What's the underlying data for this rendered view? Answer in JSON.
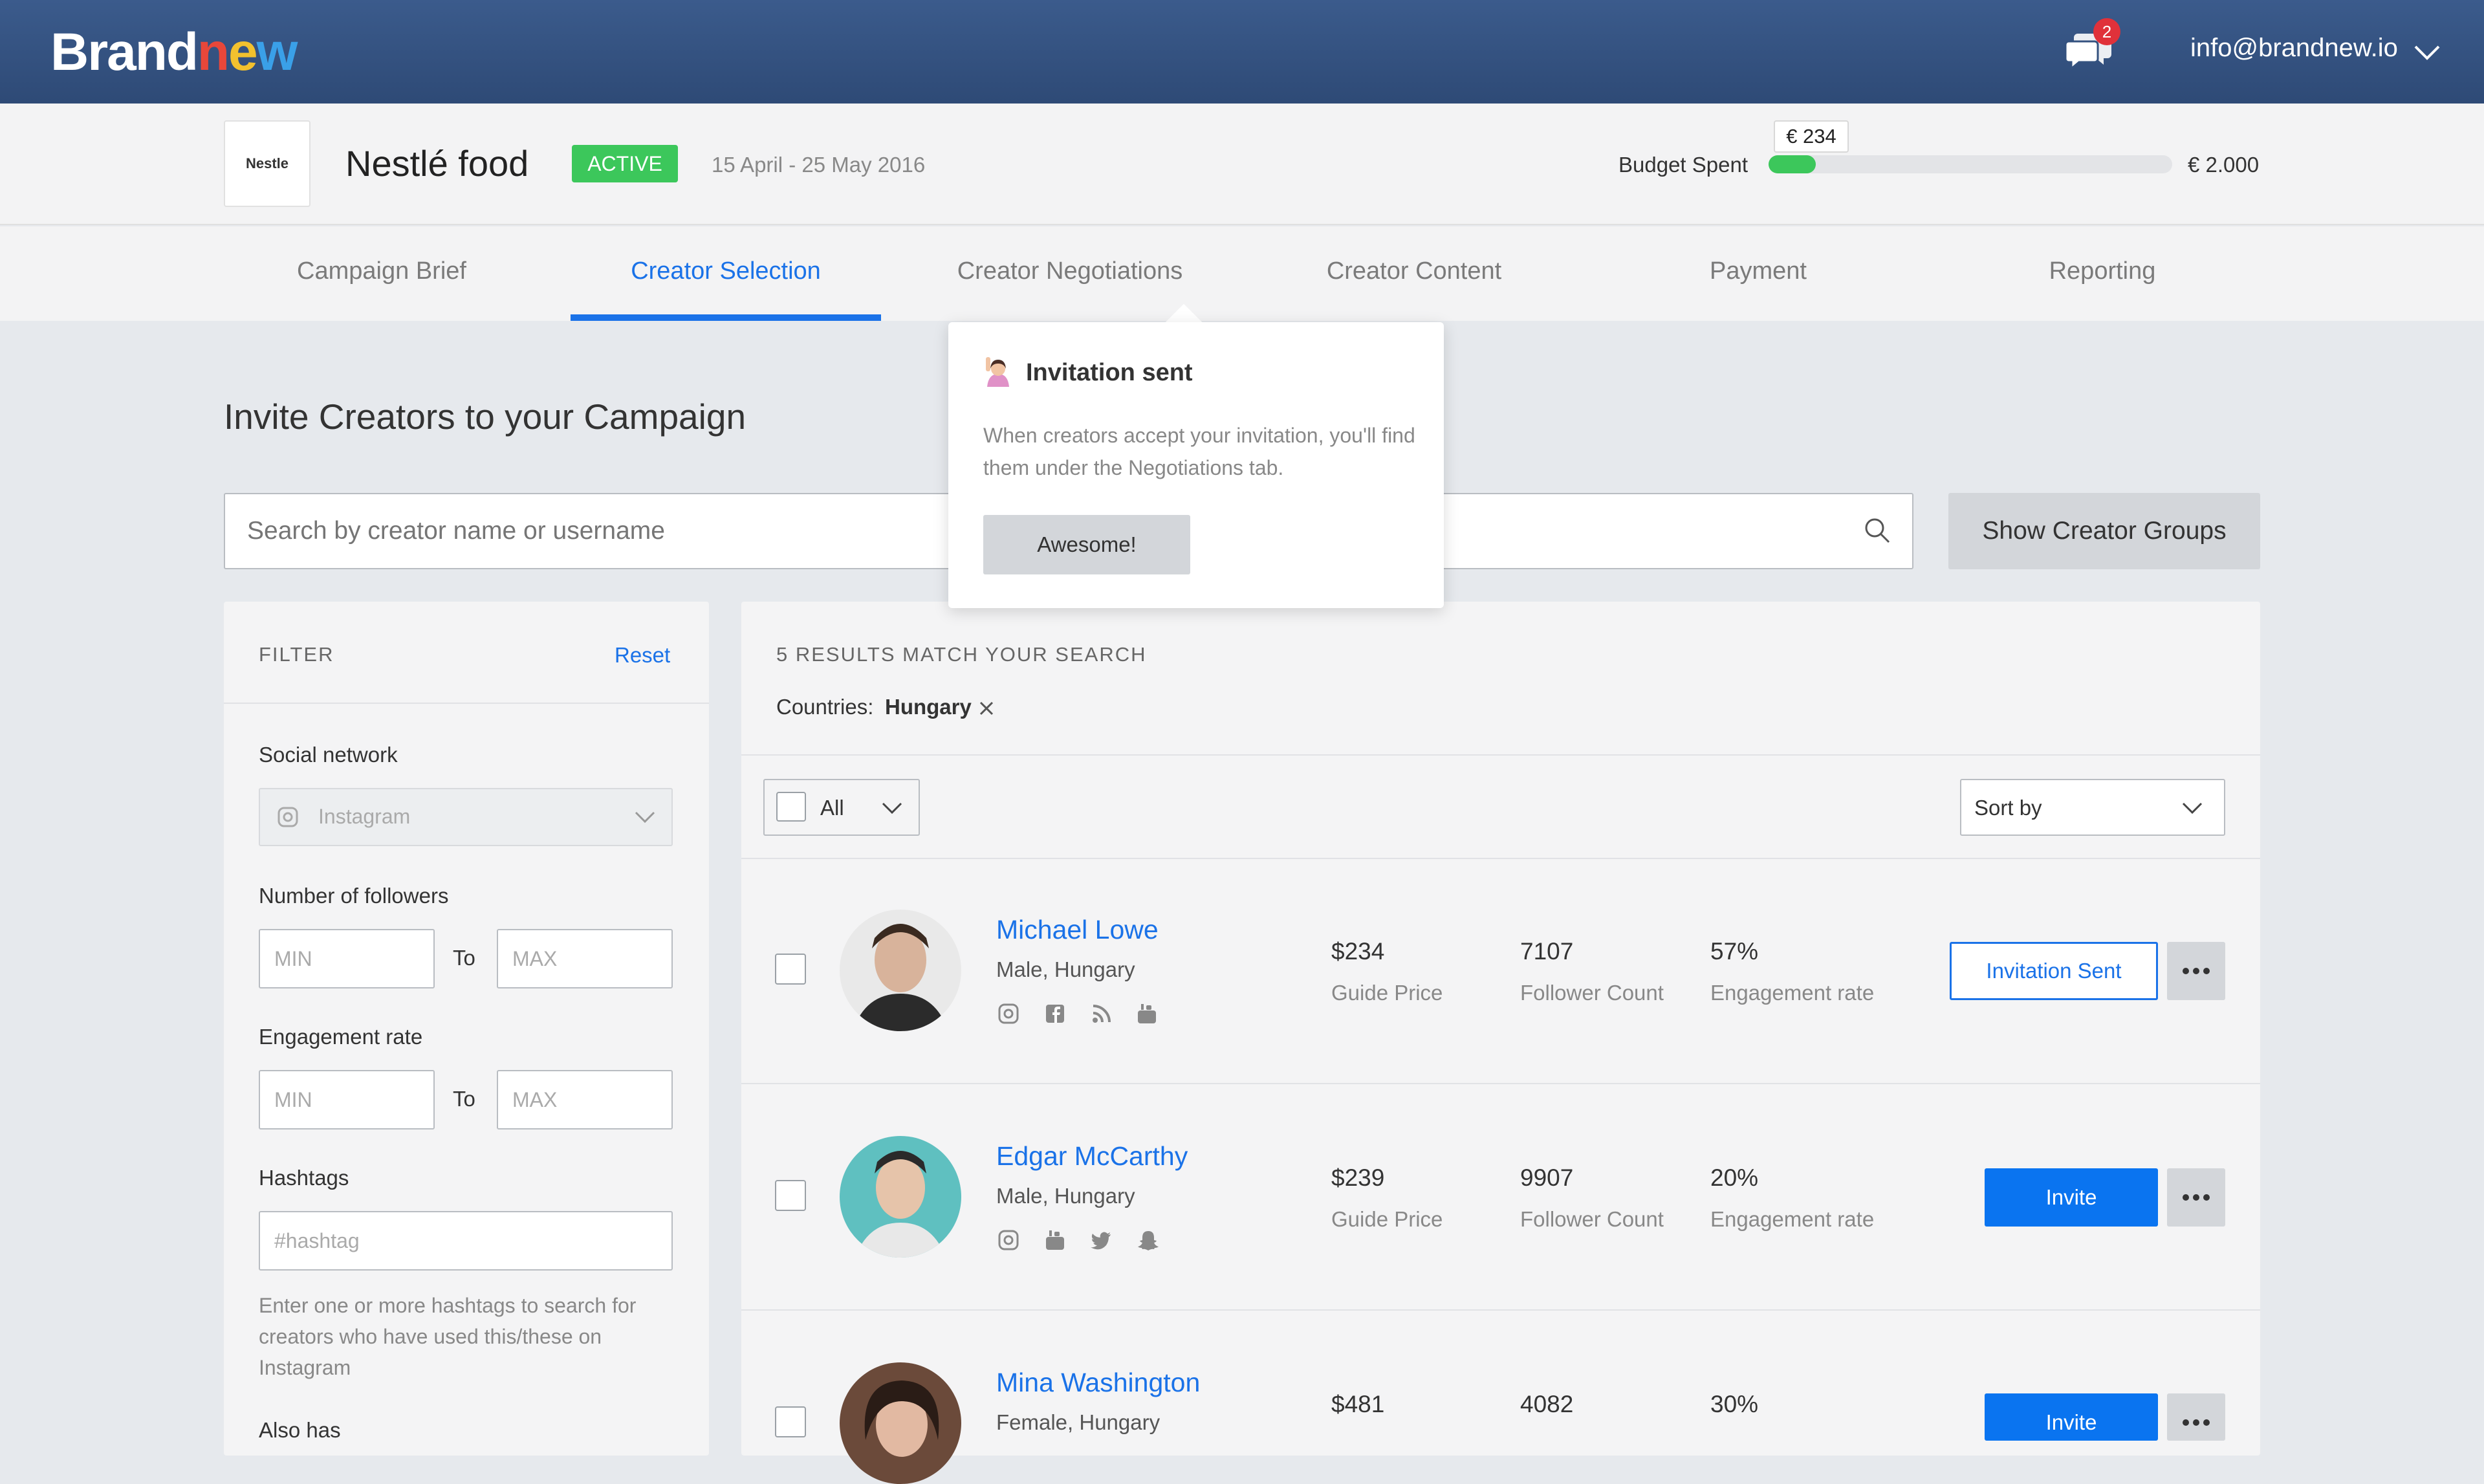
{
  "header": {
    "logo": {
      "part1": "Brand",
      "part2_n": "n",
      "part2_e": "e",
      "part2_w": "w"
    },
    "notifications_count": "2",
    "user_email": "info@brandnew.io"
  },
  "campaign": {
    "brand_logo_text": "Nestle",
    "title": "Nestlé food",
    "status": "ACTIVE",
    "dates": "15 April - 25 May 2016",
    "budget_label": "Budget Spent",
    "budget_spent": "€ 234",
    "budget_total": "€ 2.000",
    "budget_fraction": 0.117
  },
  "tabs": [
    {
      "label": "Campaign Brief"
    },
    {
      "label": "Creator Selection"
    },
    {
      "label": "Creator Negotiations"
    },
    {
      "label": "Creator Content"
    },
    {
      "label": "Payment"
    },
    {
      "label": "Reporting"
    }
  ],
  "page": {
    "heading": "Invite Creators to your Campaign",
    "search_placeholder": "Search by creator name or username",
    "show_groups_label": "Show Creator Groups"
  },
  "filter": {
    "title": "FILTER",
    "reset": "Reset",
    "social_label": "Social network",
    "social_value": "Instagram",
    "followers_label": "Number of followers",
    "engagement_label": "Engagement rate",
    "min_placeholder": "MIN",
    "max_placeholder": "MAX",
    "to": "To",
    "hashtags_label": "Hashtags",
    "hashtag_placeholder": "#hashtag",
    "hashtag_help": "Enter one or more hashtags to search for creators who have used this/these on Instagram",
    "also_has_label": "Also has"
  },
  "results": {
    "count_text": "5 RESULTS MATCH YOUR SEARCH",
    "countries_label": "Countries:",
    "countries_value": "Hungary",
    "select_all_label": "All",
    "sort_label": "Sort by",
    "price_label": "Guide Price",
    "followers_label": "Follower Count",
    "engagement_label": "Engagement rate",
    "creators": [
      {
        "name": "Michael Lowe",
        "meta": "Male, Hungary",
        "price": "$234",
        "followers": "7107",
        "engagement": "57%",
        "action": "Invitation Sent"
      },
      {
        "name": "Edgar McCarthy",
        "meta": "Male, Hungary",
        "price": "$239",
        "followers": "9907",
        "engagement": "20%",
        "action": "Invite"
      },
      {
        "name": "Mina Washington",
        "meta": "Female, Hungary",
        "price": "$481",
        "followers": "4082",
        "engagement": "30%",
        "action": "Invite"
      }
    ]
  },
  "tooltip": {
    "title": "Invitation sent",
    "body": "When creators accept your invitation, you'll find them under the Negotiations tab.",
    "button": "Awesome!"
  },
  "colors": {
    "accent": "#1a72e8",
    "success": "#3cc75b",
    "topbar": "#34527f"
  }
}
